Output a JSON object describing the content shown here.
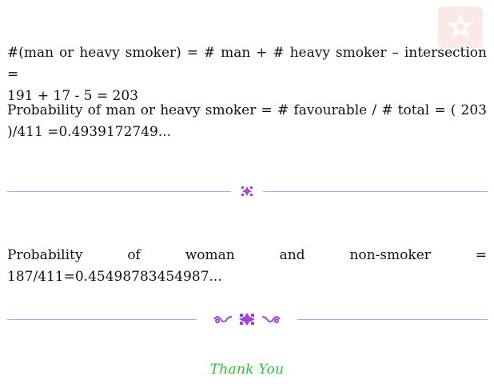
{
  "paragraphs": {
    "union_count_line1": "#(man or heavy smoker) = # man + # heavy smoker – intersection =",
    "union_count_line2": "191 + 17 - 5 = 203",
    "union_prob_line1": "Probability of man or heavy smoker = # favourable / # total = ( 203",
    "union_prob_line2": ")/411 =0.4939172749...",
    "woman_nonsmoker": "Probability of woman and non-smoker = 187/411=0.45498783454987..."
  },
  "footer": {
    "thank_you": "Thank You"
  },
  "colors": {
    "rule": "#c99ae6",
    "ornament": "#a142d6",
    "thanks": "#2ec22e",
    "watermark_bg": "#fde8e8"
  },
  "icons": {
    "watermark": "logo-star-icon",
    "divider_small": "floral-ornament-icon",
    "divider_large": "scroll-ornament-icon"
  }
}
